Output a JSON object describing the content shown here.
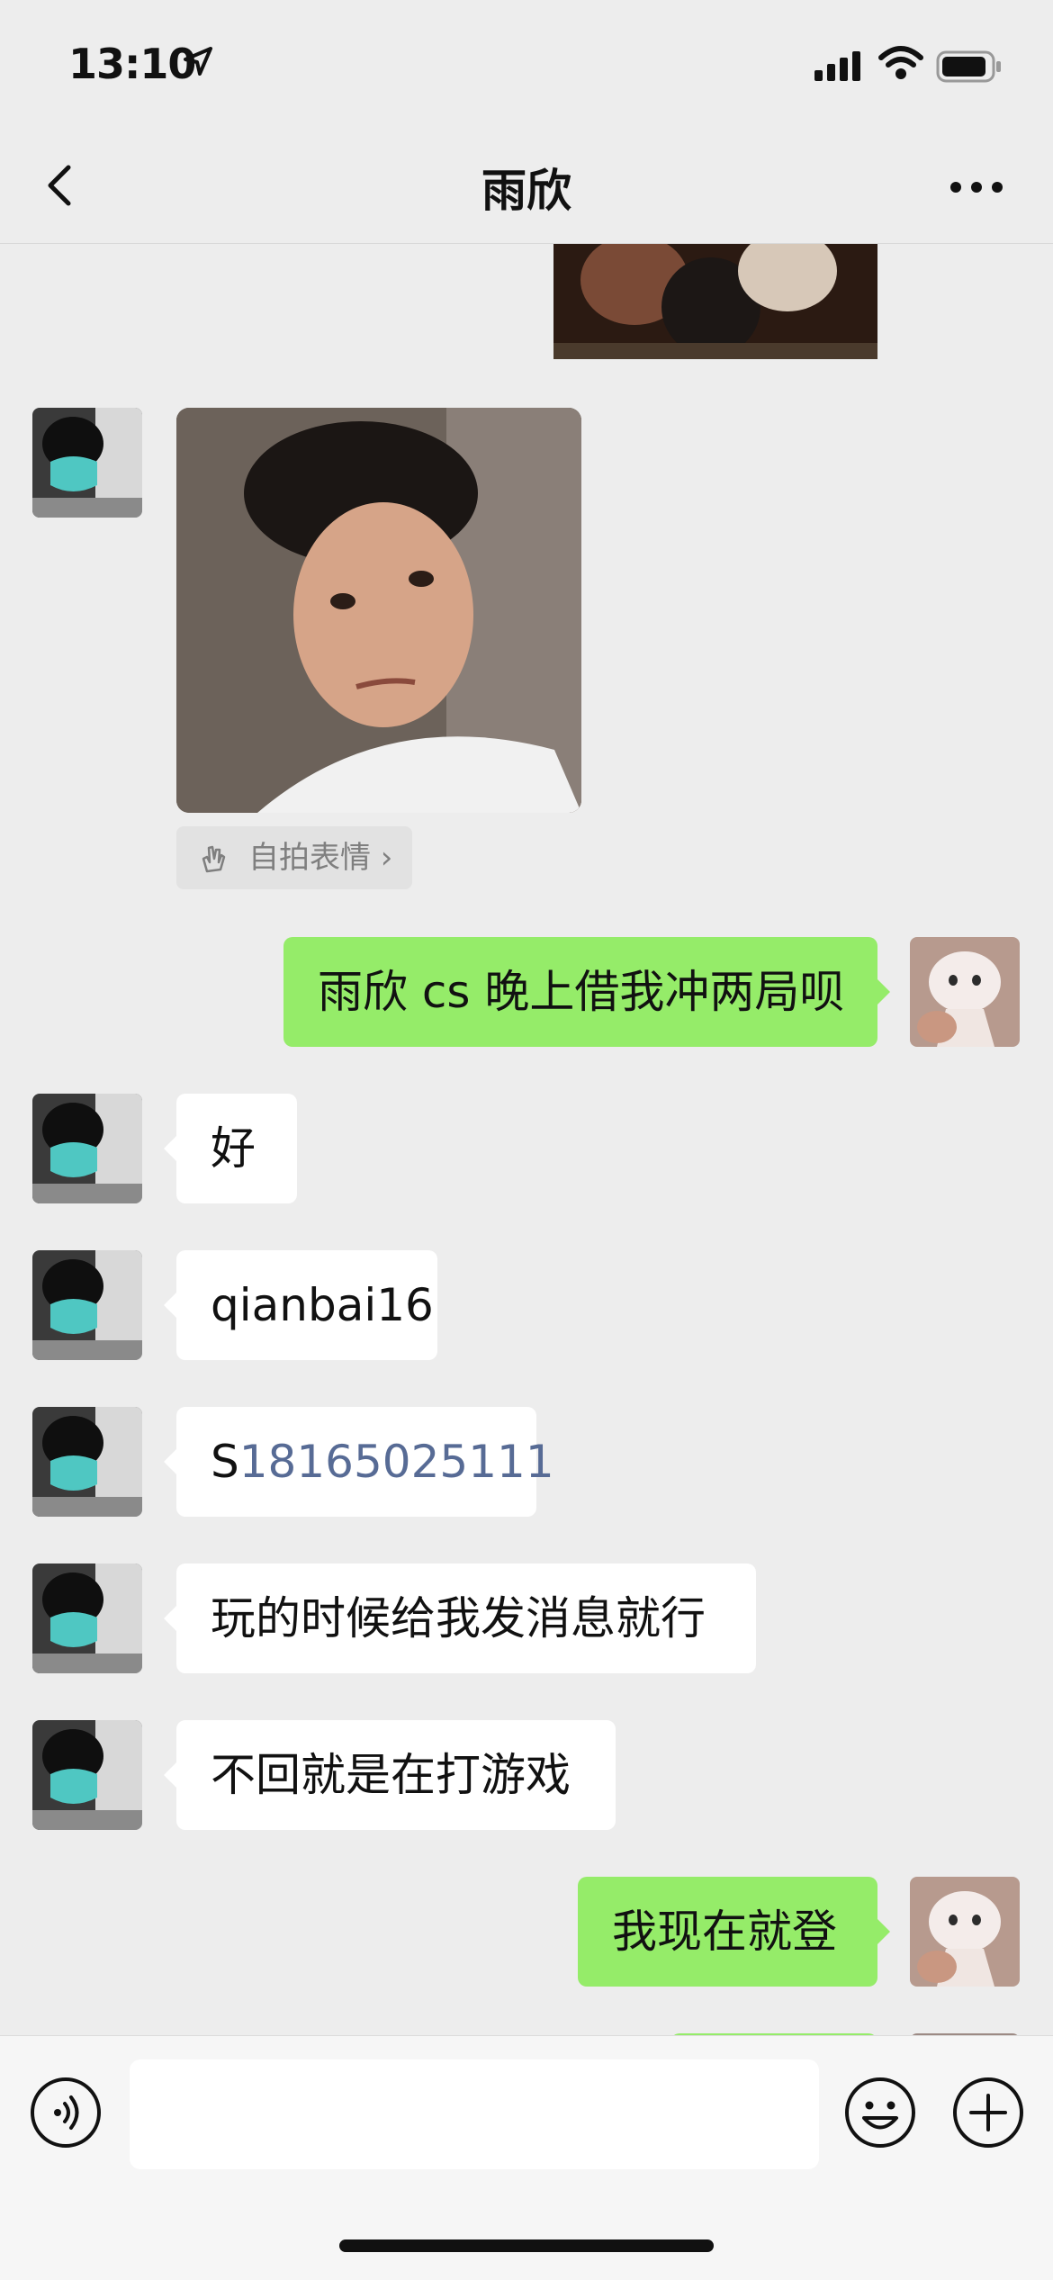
{
  "status_bar": {
    "time": "13:10"
  },
  "header": {
    "title": "雨欣"
  },
  "selfie_tag": {
    "label": "自拍表情 ›"
  },
  "messages": [
    {
      "side": "out",
      "text": "雨欣 cs 晚上借我冲两局呗"
    },
    {
      "side": "in",
      "text": "好"
    },
    {
      "side": "in",
      "text": "qianbai16"
    },
    {
      "side": "in",
      "prefix": "S",
      "link": "18165025111"
    },
    {
      "side": "in",
      "text": "玩的时候给我发消息就行"
    },
    {
      "side": "in",
      "text": "不回就是在打游戏"
    },
    {
      "side": "out",
      "text": "我现在就登"
    }
  ],
  "colors": {
    "sent_bubble": "#95ec69",
    "received_bubble": "#ffffff",
    "link": "#576b95",
    "background": "#ededed"
  }
}
